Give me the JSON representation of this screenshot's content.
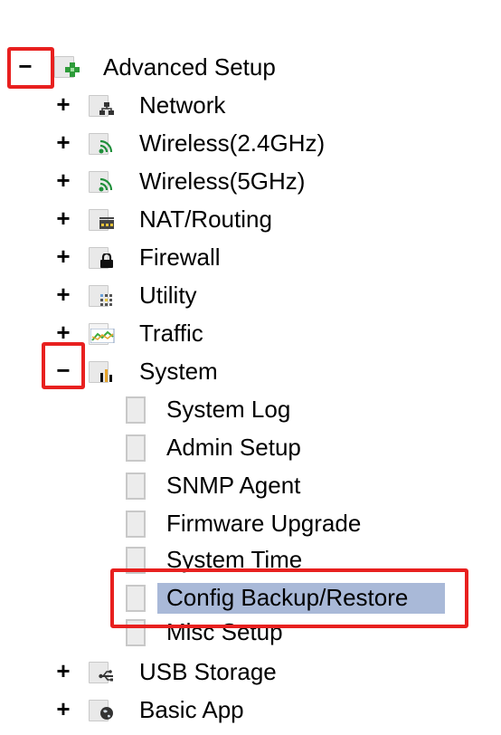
{
  "tree": {
    "root": {
      "toggle": "−",
      "label": "Advanced Setup",
      "icon": "advanced-setup-icon"
    },
    "items": [
      {
        "toggle": "+",
        "label": "Network",
        "icon": "network-icon"
      },
      {
        "toggle": "+",
        "label": "Wireless(2.4GHz)",
        "icon": "wireless-icon"
      },
      {
        "toggle": "+",
        "label": "Wireless(5GHz)",
        "icon": "wireless-icon"
      },
      {
        "toggle": "+",
        "label": "NAT/Routing",
        "icon": "nat-routing-icon"
      },
      {
        "toggle": "+",
        "label": "Firewall",
        "icon": "lock-icon"
      },
      {
        "toggle": "+",
        "label": "Utility",
        "icon": "utility-icon"
      },
      {
        "toggle": "+",
        "label": "Traffic",
        "icon": "traffic-chart-icon"
      },
      {
        "toggle": "−",
        "label": "System",
        "icon": "system-chart-icon"
      }
    ],
    "system_children": [
      {
        "label": "System Log"
      },
      {
        "label": "Admin Setup"
      },
      {
        "label": "SNMP Agent"
      },
      {
        "label": "Firmware Upgrade"
      },
      {
        "label": "System Time"
      },
      {
        "label": "Config Backup/Restore",
        "selected": true
      },
      {
        "label": "Misc Setup"
      }
    ],
    "after_items": [
      {
        "toggle": "+",
        "label": "USB Storage",
        "icon": "usb-icon"
      },
      {
        "toggle": "+",
        "label": "Basic App",
        "icon": "globe-icon"
      }
    ]
  },
  "colors": {
    "highlight_border": "#e8201f",
    "selected_background": "#a9b9d8"
  }
}
